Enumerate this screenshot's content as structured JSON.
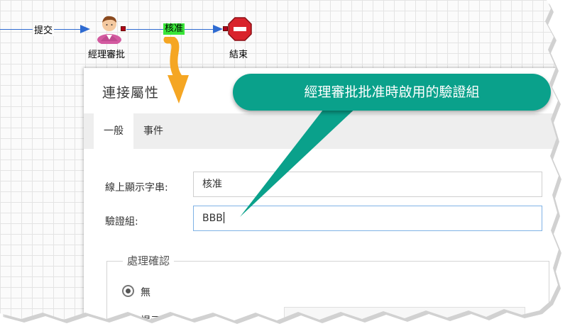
{
  "workflow": {
    "submit_label": "提交",
    "manager_node_label": "經理審批",
    "approve_label": "核准",
    "end_node_label": "結束"
  },
  "dialog": {
    "title": "連接屬性",
    "tabs": [
      {
        "label": "一般",
        "active": true
      },
      {
        "label": "事件",
        "active": false
      }
    ],
    "fields": {
      "display_string_label": "線上顯示字串:",
      "display_string_value": "核准",
      "validation_group_label": "驗證組:",
      "validation_group_value": "BBB"
    },
    "confirmation": {
      "legend": "處理確認",
      "options": [
        {
          "label": "無",
          "selected": true
        },
        {
          "label": "提示框",
          "selected": false
        }
      ]
    }
  },
  "callout": {
    "text": "經理審批批准時啟用的驗證組"
  },
  "colors": {
    "flow_line": "#2f6bd1",
    "approve_highlight": "#39e639",
    "callout_bg": "#0aa18b",
    "arrow_orange": "#f5a623",
    "input_focus_border": "#7fb2e5"
  },
  "icons": {
    "manager_node": "user-avatar-icon",
    "end_node": "stop-sign-icon",
    "pointer": "orange-down-arrow-icon"
  }
}
